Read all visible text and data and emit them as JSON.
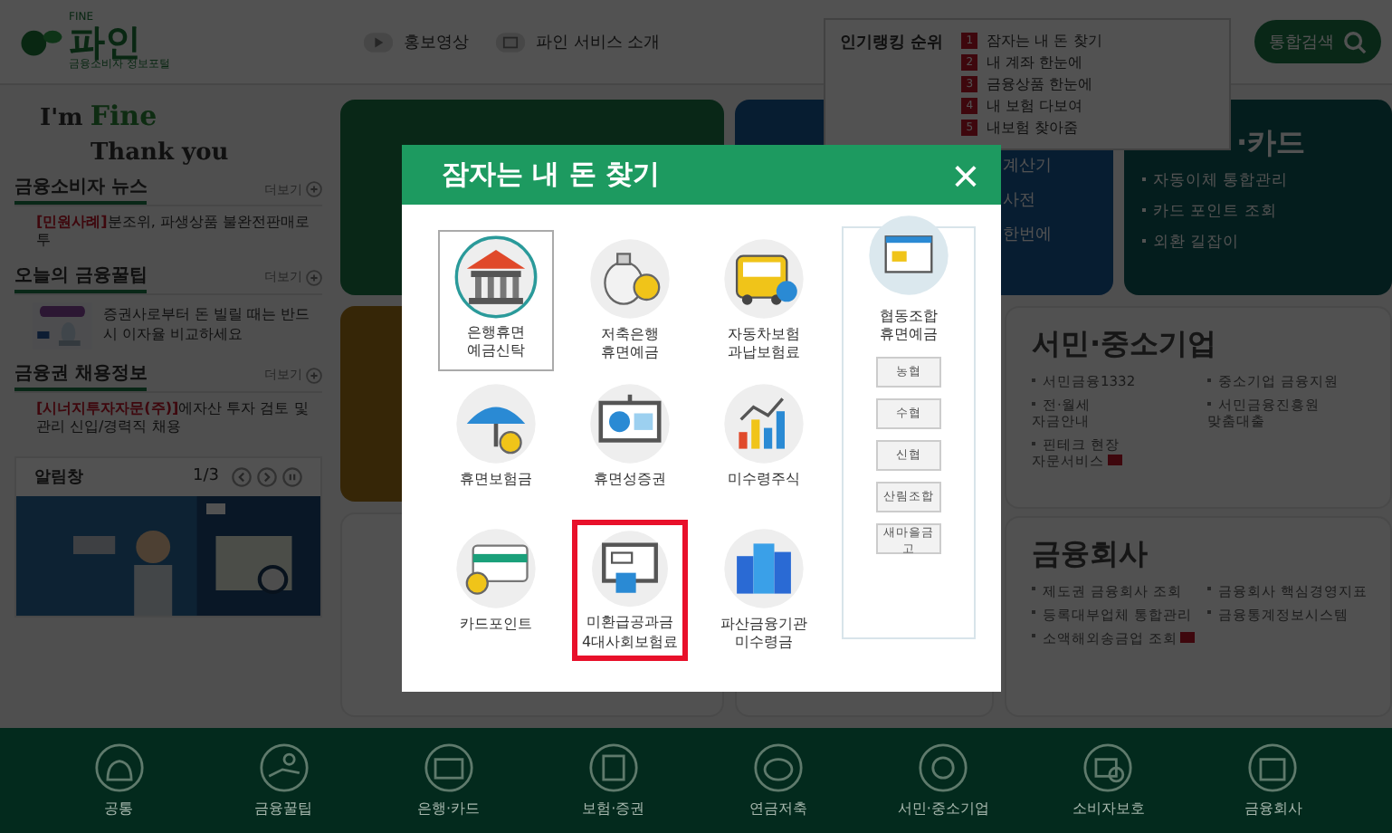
{
  "header": {
    "logo": {
      "small": "FINE",
      "name": "파인",
      "tagline": "금융소비자 정보포털"
    },
    "links": [
      {
        "label": "홍보영상"
      },
      {
        "label": "파인 서비스 소개"
      }
    ],
    "ranking": {
      "title": "인기랭킹 순위",
      "items": [
        {
          "rank": "1",
          "label": "잠자는 내 돈 찾기"
        },
        {
          "rank": "2",
          "label": "내 계좌 한눈에"
        },
        {
          "rank": "3",
          "label": "금융상품 한눈에"
        },
        {
          "rank": "4",
          "label": "내 보험 다보여"
        },
        {
          "rank": "5",
          "label": "내보험 찾아줌"
        }
      ]
    },
    "search_button": "통합검색"
  },
  "sidebar": {
    "slogan": {
      "im": "I'm",
      "fine": "Fine",
      "thanks": "Thank you"
    },
    "sections": [
      {
        "title": "금융소비자 뉴스",
        "more": "더보기",
        "kind": "news",
        "tag": "[민원사례]",
        "text": "분조위, 파생상품 불완전판매로 투"
      },
      {
        "title": "오늘의 금융꿀팁",
        "more": "더보기",
        "kind": "tip",
        "text": "증권사로부터 돈 빌릴 때는 반드시 이자율 비교하세요"
      },
      {
        "title": "금융권 채용정보",
        "more": "더보기",
        "kind": "news",
        "tag": "[시너지투자자문(주)]",
        "text": "에자산 투자 검토 및 관리 신입/경력직 채용"
      }
    ],
    "notice": {
      "title": "알림창",
      "page": "1/3"
    }
  },
  "cards": {
    "blue_items": [
      "계산기",
      "사전",
      "한번에"
    ],
    "card_title": "·카드",
    "card_items": [
      "자동이체 통합관리",
      "카드 포인트 조회",
      "외환 길잡이"
    ],
    "sections": [
      {
        "title": "서민·중소기업",
        "items": [
          {
            "label": "서민금융1332",
            "new": false
          },
          {
            "label": "중소기업 금융지원",
            "new": false
          },
          {
            "label": "전·월세\n자금안내",
            "new": false
          },
          {
            "label": "서민금융진흥원\n맞춤대출",
            "new": false
          },
          {
            "label": "핀테크 현장\n자문서비스",
            "new": true
          }
        ]
      },
      {
        "title": "금융회사",
        "items": [
          {
            "label": "제도권 금융회사 조회",
            "new": false
          },
          {
            "label": "금융회사 핵심경영지표",
            "new": false
          },
          {
            "label": "등록대부업체 통합관리",
            "new": false
          },
          {
            "label": "금융통계정보시스템",
            "new": false
          },
          {
            "label": "소액해외송금업 조회",
            "new": true
          }
        ]
      }
    ]
  },
  "footer_nav": [
    {
      "label": "공통"
    },
    {
      "label": "금융꿀팁"
    },
    {
      "label": "은행·카드"
    },
    {
      "label": "보험·증권"
    },
    {
      "label": "연금저축"
    },
    {
      "label": "서민·중소기업"
    },
    {
      "label": "소비자보호"
    },
    {
      "label": "금융회사"
    }
  ],
  "modal": {
    "title": "잠자는 내 돈 찾기",
    "close": "×",
    "items": [
      {
        "label": "은행휴면\n예금신탁",
        "selected": true,
        "highlighted": false
      },
      {
        "label": "저축은행\n휴면예금",
        "selected": false,
        "highlighted": false
      },
      {
        "label": "자동차보험\n과납보험료",
        "selected": false,
        "highlighted": false
      },
      {
        "label": "휴면보험금",
        "selected": false,
        "highlighted": false
      },
      {
        "label": "휴면성증권",
        "selected": false,
        "highlighted": false
      },
      {
        "label": "미수령주식",
        "selected": false,
        "highlighted": false
      },
      {
        "label": "카드포인트",
        "selected": false,
        "highlighted": false
      },
      {
        "label": "미환급공과금\n4대사회보험료",
        "selected": false,
        "highlighted": true
      },
      {
        "label": "파산금융기관\n미수령금",
        "selected": false,
        "highlighted": false
      }
    ],
    "coop": {
      "label": "협동조합\n휴면예금",
      "buttons": [
        "농협",
        "수협",
        "신협",
        "산림조합",
        "새마을금고"
      ]
    }
  }
}
